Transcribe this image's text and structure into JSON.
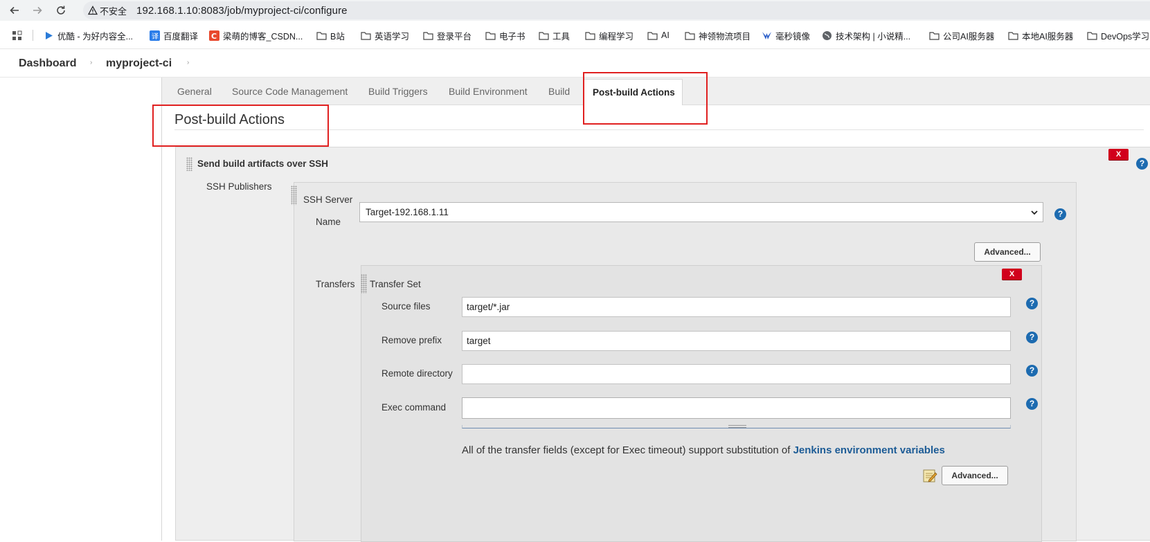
{
  "browser": {
    "insecure_label": "不安全",
    "url": "192.168.1.10:8083/job/myproject-ci/configure"
  },
  "bookmarks": [
    {
      "label": "优酷 - 为好内容全..."
    },
    {
      "label": "百度翻译"
    },
    {
      "label": "梁萌的博客_CSDN..."
    },
    {
      "label": "B站"
    },
    {
      "label": "英语学习"
    },
    {
      "label": "登录平台"
    },
    {
      "label": "电子书"
    },
    {
      "label": "工具"
    },
    {
      "label": "编程学习"
    },
    {
      "label": "AI"
    },
    {
      "label": "神领物流项目"
    },
    {
      "label": "毫秒镜像"
    },
    {
      "label": "技术架构 | 小说精..."
    },
    {
      "label": "公司AI服务器"
    },
    {
      "label": "本地AI服务器"
    },
    {
      "label": "DevOps学习"
    }
  ],
  "breadcrumb": {
    "dashboard": "Dashboard",
    "project": "myproject-ci",
    "sep": "›"
  },
  "tabs": [
    {
      "label": "General"
    },
    {
      "label": "Source Code Management"
    },
    {
      "label": "Build Triggers"
    },
    {
      "label": "Build Environment"
    },
    {
      "label": "Build"
    },
    {
      "label": "Post-build Actions"
    }
  ],
  "section": {
    "title": "Post-build Actions"
  },
  "publisher": {
    "title": "Send build artifacts over SSH",
    "delete_label": "X",
    "help_label": "?",
    "ssh_publishers_label": "SSH Publishers",
    "ssh_server_label": "SSH Server",
    "name_label": "Name",
    "name_value": "Target-192.168.1.11",
    "advanced_label": "Advanced...",
    "transfers_label": "Transfers",
    "transfer_set": {
      "title": "Transfer Set",
      "delete_label": "X",
      "source_files_label": "Source files",
      "source_files_value": "target/*.jar",
      "remove_prefix_label": "Remove prefix",
      "remove_prefix_value": "target",
      "remote_directory_label": "Remote directory",
      "remote_directory_value": "",
      "exec_command_label": "Exec command",
      "exec_command_value": "",
      "note_text": "All of the transfer fields (except for Exec timeout) support substitution of ",
      "note_link": "Jenkins environment variables",
      "advanced_label": "Advanced..."
    }
  },
  "colors": {
    "highlight": "#e02020",
    "help": "#1d6bb0",
    "delete": "#d1001c"
  }
}
